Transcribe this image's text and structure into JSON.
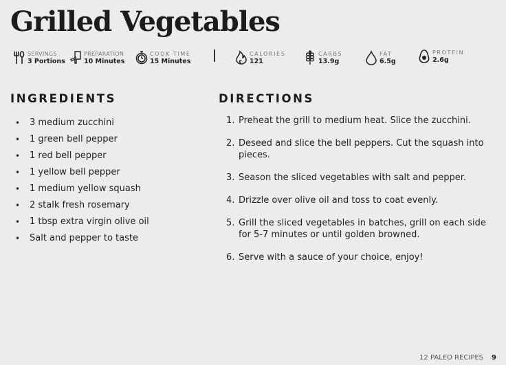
{
  "title": "Grilled Vegetables",
  "stats": [
    {
      "icon": "fork-spoon-icon",
      "label": "SERVINGS",
      "value": "3 Portions"
    },
    {
      "icon": "knife-board-icon",
      "label": "PREPARATION",
      "value": "10 Minutes"
    },
    {
      "icon": "stopwatch-icon",
      "label": "COOK TIME",
      "value": "15 Minutes"
    },
    {
      "icon": "flame-icon",
      "label": "CALORIES",
      "value": "121"
    },
    {
      "icon": "wheat-icon",
      "label": "CARBS",
      "value": "13.9g"
    },
    {
      "icon": "drop-icon",
      "label": "FAT",
      "value": "6.5g"
    },
    {
      "icon": "avocado-icon",
      "label": "PROTEIN",
      "value": "2.6g"
    }
  ],
  "ingredients": {
    "heading": "INGREDIENTS",
    "bullet": "•",
    "items": [
      "3 medium zucchini",
      "1 green bell pepper",
      "1 red bell pepper",
      "1 yellow bell pepper",
      "1 medium yellow squash",
      "2 stalk fresh rosemary",
      "1 tbsp extra virgin olive oil",
      "Salt and pepper to taste"
    ]
  },
  "directions": {
    "heading": "DIRECTIONS",
    "steps": [
      {
        "num": "1.",
        "text": "Preheat the grill to medium heat. Slice the zucchini."
      },
      {
        "num": "2.",
        "text": "Deseed and slice the bell peppers. Cut the squash into pieces."
      },
      {
        "num": "3.",
        "text": "Season the sliced vegetables with salt and pepper."
      },
      {
        "num": "4.",
        "text": "Drizzle over olive oil and toss to coat evenly."
      },
      {
        "num": "5.",
        "text": "Grill the sliced vegetables in batches, grill on each side for 5-7 minutes or until golden browned."
      },
      {
        "num": "6.",
        "text": "Serve with a sauce of your choice, enjoy!"
      }
    ]
  },
  "footer": {
    "book": "12 PALEO RECIPES",
    "page": "9"
  }
}
